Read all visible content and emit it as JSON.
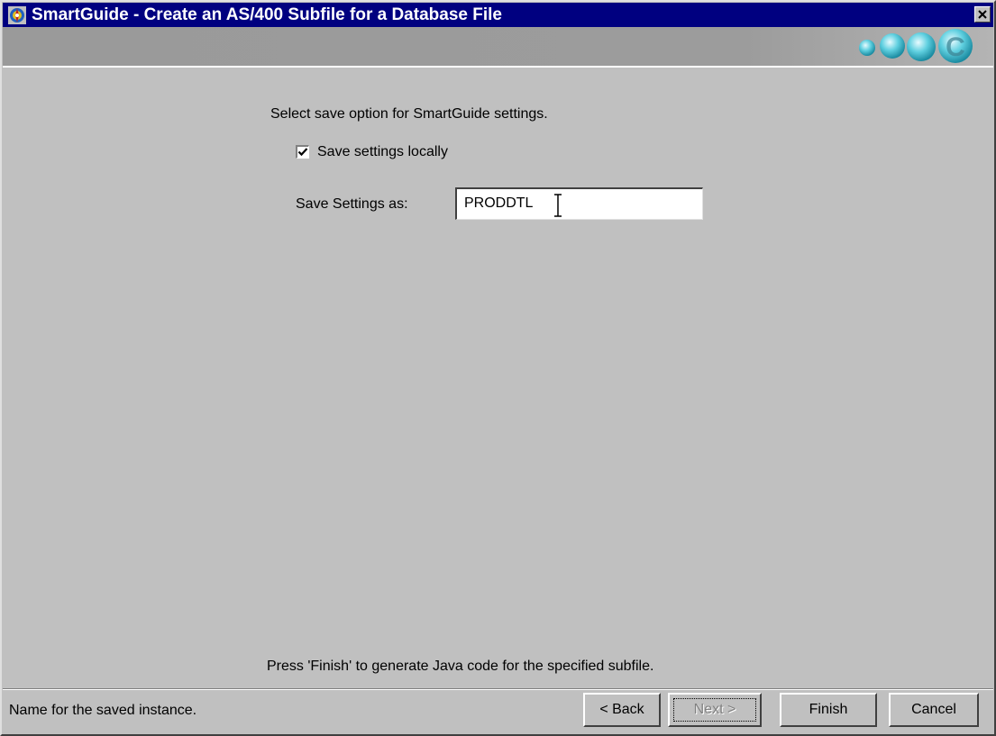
{
  "window": {
    "title": "SmartGuide - Create an AS/400 Subfile for a Database File",
    "close_glyph": "×",
    "app_icon": "smartguide-app-icon",
    "logo": "decorative-circles-logo"
  },
  "content": {
    "prompt": "Select save option for SmartGuide settings.",
    "save_locally": {
      "label": "Save settings locally",
      "checked": true
    },
    "save_as": {
      "label": "Save Settings as:",
      "value": "PRODDTL"
    },
    "instruction": "Press 'Finish' to generate Java code for the specified subfile."
  },
  "status_text": "Name for the saved instance.",
  "buttons": {
    "back": {
      "label": "< Back",
      "enabled": true
    },
    "next": {
      "label": "Next >",
      "enabled": false
    },
    "finish": {
      "label": "Finish",
      "enabled": true
    },
    "cancel": {
      "label": "Cancel",
      "enabled": true
    }
  },
  "colors": {
    "title_bar": "#000080",
    "dialog_face": "#c0c0c0",
    "logo_teal": "#38b8c8"
  }
}
